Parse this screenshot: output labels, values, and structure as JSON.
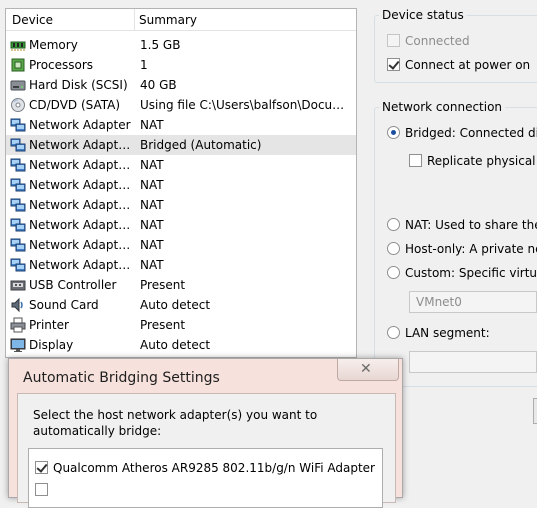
{
  "device_list": {
    "headers": {
      "device": "Device",
      "summary": "Summary"
    },
    "rows": [
      {
        "icon": "memory-icon",
        "name": "Memory",
        "summary": "1.5 GB"
      },
      {
        "icon": "processor-icon",
        "name": "Processors",
        "summary": "1"
      },
      {
        "icon": "hard-disk-icon",
        "name": "Hard Disk (SCSI)",
        "summary": "40 GB"
      },
      {
        "icon": "cd-dvd-icon",
        "name": "CD/DVD (SATA)",
        "summary": "Using file C:\\Users\\balfson\\Docum..."
      },
      {
        "icon": "network-adapter-icon",
        "name": "Network Adapter",
        "summary": "NAT"
      },
      {
        "icon": "network-adapter-icon",
        "name": "Network Adapte...",
        "summary": "Bridged (Automatic)"
      },
      {
        "icon": "network-adapter-icon",
        "name": "Network Adapte...",
        "summary": "NAT"
      },
      {
        "icon": "network-adapter-icon",
        "name": "Network Adapte...",
        "summary": "NAT"
      },
      {
        "icon": "network-adapter-icon",
        "name": "Network Adapte...",
        "summary": "NAT"
      },
      {
        "icon": "network-adapter-icon",
        "name": "Network Adapte...",
        "summary": "NAT"
      },
      {
        "icon": "network-adapter-icon",
        "name": "Network Adapte...",
        "summary": "NAT"
      },
      {
        "icon": "network-adapter-icon",
        "name": "Network Adapte...",
        "summary": "NAT"
      },
      {
        "icon": "usb-icon",
        "name": "USB Controller",
        "summary": "Present"
      },
      {
        "icon": "sound-card-icon",
        "name": "Sound Card",
        "summary": "Auto detect"
      },
      {
        "icon": "printer-icon",
        "name": "Printer",
        "summary": "Present"
      },
      {
        "icon": "display-icon",
        "name": "Display",
        "summary": "Auto detect"
      }
    ],
    "selected_index": 5
  },
  "device_status": {
    "title": "Device status",
    "connected": {
      "label": "Connected",
      "checked": false,
      "disabled": true
    },
    "connect_at_power_on": {
      "label": "Connect at power on",
      "checked": true
    }
  },
  "network_connection": {
    "title": "Network connection",
    "bridged": {
      "label": "Bridged: Connected dir",
      "checked": true
    },
    "replicate": {
      "label": "Replicate physical n",
      "checked": false
    },
    "nat": {
      "label": "NAT: Used to share the"
    },
    "host_only": {
      "label": "Host-only: A private ne"
    },
    "custom": {
      "label": "Custom: Specific virtua"
    },
    "vmnet_select": {
      "value": "VMnet0"
    },
    "lan_segment": {
      "label": "LAN segment:"
    }
  },
  "dialog": {
    "title": "Automatic Bridging Settings",
    "close_glyph": "✕",
    "prompt": "Select the host network adapter(s) you want to automatically bridge:",
    "adapters": [
      {
        "label": "Qualcomm Atheros AR9285 802.11b/g/n WiFi Adapter",
        "checked": true
      },
      {
        "label": "",
        "checked": false
      }
    ]
  },
  "colors": {
    "selected_row": "#e5e5e5",
    "dialog_frame": "#f6e1dc",
    "radio_dot": "#1a4fa0",
    "disabled_text": "#8d8d8d"
  }
}
